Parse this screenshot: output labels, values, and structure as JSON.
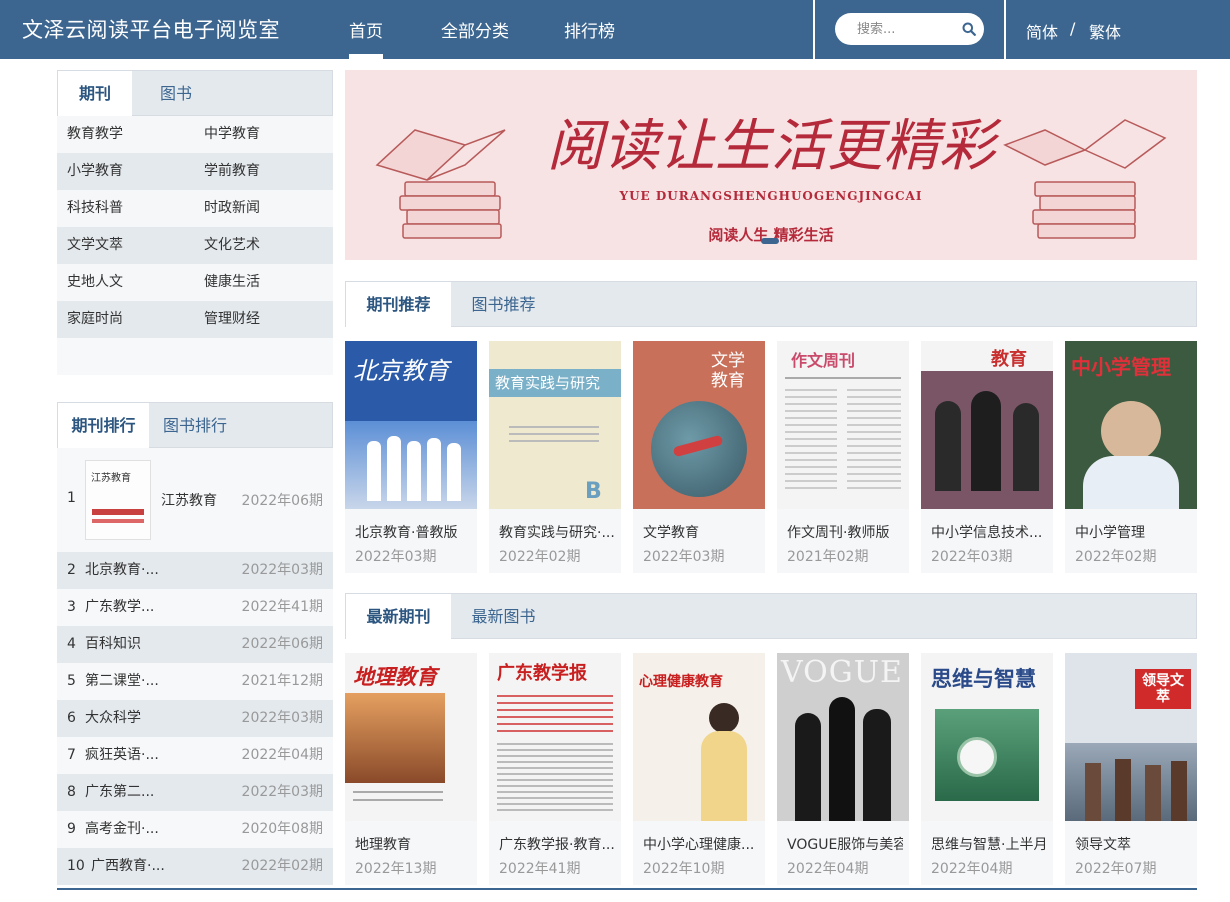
{
  "header": {
    "title": "文泽云阅读平台电子阅览室",
    "nav": [
      "首页",
      "全部分类",
      "排行榜"
    ],
    "search_placeholder": "搜索...",
    "lang_simplified": "简体",
    "lang_sep": "/",
    "lang_traditional": "繁体"
  },
  "category_panel": {
    "tabs": [
      "期刊",
      "图书"
    ],
    "rows": [
      [
        "教育教学",
        "中学教育"
      ],
      [
        "小学教育",
        "学前教育"
      ],
      [
        "科技科普",
        "时政新闻"
      ],
      [
        "文学文萃",
        "文化艺术"
      ],
      [
        "史地人文",
        "健康生活"
      ],
      [
        "家庭时尚",
        "管理财经"
      ]
    ]
  },
  "rank_panel": {
    "tabs": [
      "期刊排行",
      "图书排行"
    ],
    "first": {
      "num": "1",
      "name": "江苏教育",
      "issue": "2022年06期",
      "thumb_text": "江苏教育"
    },
    "items": [
      {
        "num": "2",
        "name": "北京教育·...",
        "issue": "2022年03期"
      },
      {
        "num": "3",
        "name": "广东教学...",
        "issue": "2022年41期"
      },
      {
        "num": "4",
        "name": "百科知识",
        "issue": "2022年06期"
      },
      {
        "num": "5",
        "name": "第二课堂·...",
        "issue": "2021年12期"
      },
      {
        "num": "6",
        "name": "大众科学",
        "issue": "2022年03期"
      },
      {
        "num": "7",
        "name": "疯狂英语·...",
        "issue": "2022年04期"
      },
      {
        "num": "8",
        "name": "广东第二...",
        "issue": "2022年03期"
      },
      {
        "num": "9",
        "name": "高考金刊·...",
        "issue": "2020年08期"
      },
      {
        "num": "10",
        "name": "广西教育·...",
        "issue": "2022年02期"
      }
    ]
  },
  "banner": {
    "headline": "阅读让生活更精彩",
    "pinyin": "YUE DURANGSHENGHUOGENGJINGCAI",
    "tagline": "阅读人生 精彩生活"
  },
  "recommend_section": {
    "tabs": [
      "期刊推荐",
      "图书推荐"
    ],
    "cards": [
      {
        "title": "北京教育·普教版",
        "issue": "2022年03期",
        "cover_text": "北京教育",
        "cover_color": "#2a5aa8"
      },
      {
        "title": "教育实践与研究·...",
        "issue": "2022年02期",
        "cover_text": "教育实践与研究",
        "cover_color": "#efe9cf"
      },
      {
        "title": "文学教育",
        "issue": "2022年03期",
        "cover_text": "文学教育",
        "cover_color": "#c9705a"
      },
      {
        "title": "作文周刊·教师版",
        "issue": "2021年02期",
        "cover_text": "作文周刊",
        "cover_color": "#f2f2f2"
      },
      {
        "title": "中小学信息技术...",
        "issue": "2022年03期",
        "cover_text": "教育",
        "cover_color": "#7a5566"
      },
      {
        "title": "中小学管理",
        "issue": "2022年02期",
        "cover_text": "中小学管理",
        "cover_color": "#3c5a40"
      }
    ]
  },
  "latest_section": {
    "tabs": [
      "最新期刊",
      "最新图书"
    ],
    "cards": [
      {
        "title": "地理教育",
        "issue": "2022年13期",
        "cover_text": "地理教育",
        "cover_color": "#e5a060"
      },
      {
        "title": "广东教学报·教育...",
        "issue": "2022年41期",
        "cover_text": "广东教学报",
        "cover_color": "#f4f4f4"
      },
      {
        "title": "中小学心理健康...",
        "issue": "2022年10期",
        "cover_text": "心理健康教育",
        "cover_color": "#f6f0ea"
      },
      {
        "title": "VOGUE服饰与美容",
        "issue": "2022年04期",
        "cover_text": "VOGUE",
        "cover_color": "#cfcfcf"
      },
      {
        "title": "思维与智慧·上半月",
        "issue": "2022年04期",
        "cover_text": "思维与智慧",
        "cover_color": "#5aa07a"
      },
      {
        "title": "领导文萃",
        "issue": "2022年07期",
        "cover_text": "领导文萃",
        "cover_color": "#8a9ab0"
      }
    ]
  }
}
